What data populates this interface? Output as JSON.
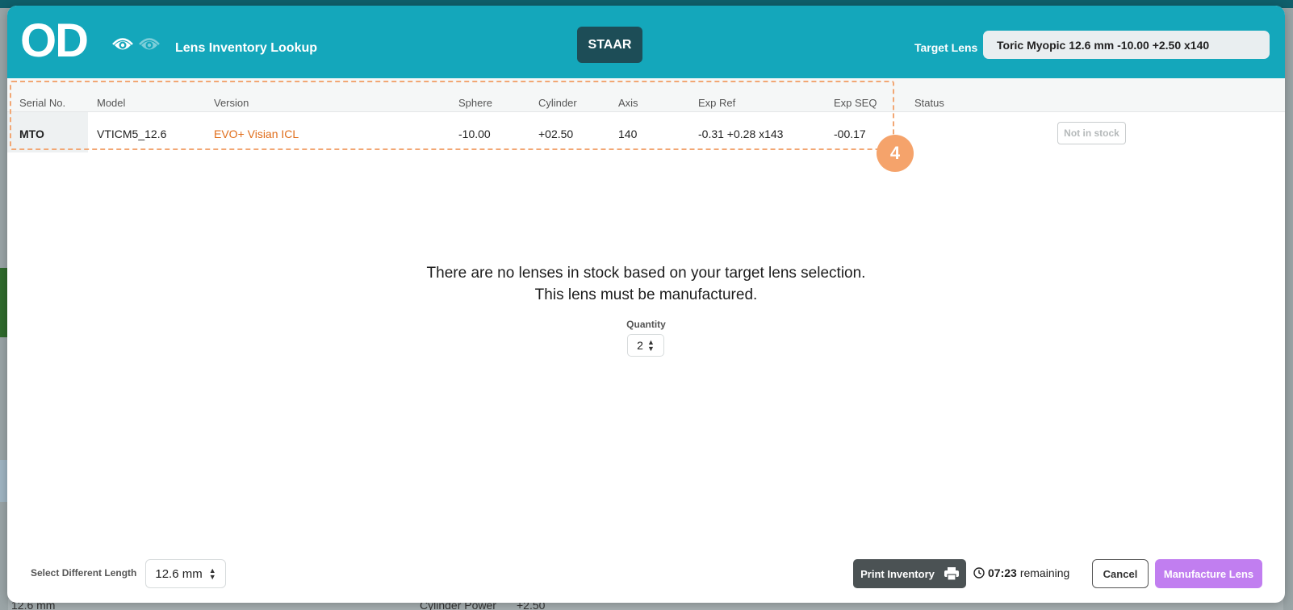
{
  "header": {
    "logo": "OD",
    "title": "Lens Inventory Lookup",
    "brand": "STAAR",
    "target_label": "Target Lens",
    "target_value": "Toric Myopic 12.6 mm -10.00 +2.50 x140"
  },
  "table": {
    "columns": [
      "Serial No.",
      "Model",
      "Version",
      "Sphere",
      "Cylinder",
      "Axis",
      "Exp Ref",
      "Exp SEQ",
      "Status"
    ],
    "rows": [
      {
        "serial": "MTO",
        "model": "VTICM5_12.6",
        "version": "EVO+ Visian ICL",
        "sphere": "-10.00",
        "cylinder": "+02.50",
        "axis": "140",
        "exp_ref": "-0.31 +0.28 x143",
        "exp_seq": "-00.17",
        "status": "Not in stock"
      }
    ]
  },
  "annotation": {
    "step": "4"
  },
  "message": {
    "line1": "There are no lenses in stock based on your target lens selection.",
    "line2": "This lens must be manufactured."
  },
  "quantity": {
    "label": "Quantity",
    "value": "2"
  },
  "footer": {
    "length_label": "Select Different Length",
    "length_value": "12.6 mm",
    "print_label": "Print Inventory",
    "time": "07:23",
    "time_suffix": "remaining",
    "cancel_label": "Cancel",
    "manufacture_label": "Manufacture Lens"
  },
  "background": {
    "length_value": "12.6 mm",
    "field_label": "Cylinder Power",
    "field_value": "+2.50"
  },
  "colors": {
    "header": "#14a7bb",
    "brand_badge": "#1d4d57",
    "version_text": "#e06d1a",
    "annotation": "#f5a36b",
    "primary_button": "#c17ef0",
    "print_button": "#4b5254"
  }
}
